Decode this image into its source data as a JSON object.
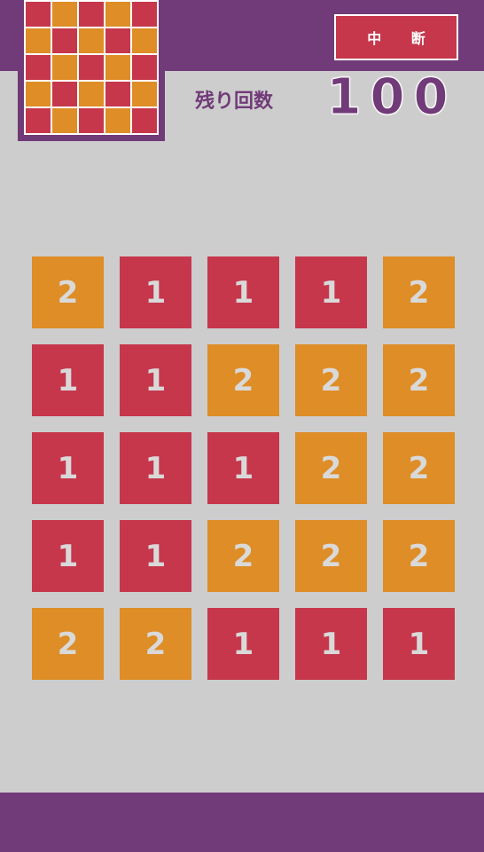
{
  "header": {
    "abort_label": "中 断",
    "remaining_label": "残り回数",
    "remaining_count": "100"
  },
  "colors": {
    "purple": "#713a78",
    "red": "#c6374c",
    "orange": "#de8d27",
    "background": "#cdcdcd",
    "tile_text": "#d9d9d9"
  },
  "target_pattern": [
    [
      "red",
      "orange",
      "red",
      "orange",
      "red"
    ],
    [
      "orange",
      "red",
      "orange",
      "red",
      "orange"
    ],
    [
      "red",
      "orange",
      "red",
      "orange",
      "red"
    ],
    [
      "orange",
      "red",
      "orange",
      "red",
      "orange"
    ],
    [
      "red",
      "orange",
      "red",
      "orange",
      "red"
    ]
  ],
  "board": [
    [
      "2",
      "1",
      "1",
      "1",
      "2"
    ],
    [
      "1",
      "1",
      "2",
      "2",
      "2"
    ],
    [
      "1",
      "1",
      "1",
      "2",
      "2"
    ],
    [
      "1",
      "1",
      "2",
      "2",
      "2"
    ],
    [
      "2",
      "2",
      "1",
      "1",
      "1"
    ]
  ]
}
